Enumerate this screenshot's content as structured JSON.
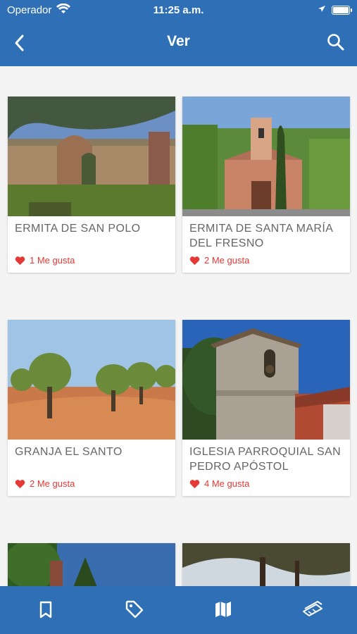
{
  "status": {
    "carrier": "Operador",
    "time": "11:25 a.m."
  },
  "nav": {
    "title": "Ver",
    "back_icon": "chevron-left-icon",
    "search_icon": "search-icon"
  },
  "places": [
    {
      "name": "ERMITA DE SAN POLO",
      "likes": "1 Me gusta"
    },
    {
      "name": "ERMITA DE SANTA MARÍA DEL FRESNO",
      "likes": "2 Me gusta"
    },
    {
      "name": "GRANJA EL SANTO",
      "likes": "2 Me gusta"
    },
    {
      "name": "IGLESIA PARROQUIAL SAN PEDRO APÓSTOL",
      "likes": "4 Me gusta"
    }
  ],
  "tabs": [
    "bookmark-icon",
    "tag-icon",
    "map-icon",
    "ticket-icon"
  ],
  "colors": {
    "brand": "#2f6fb6",
    "like": "#e53935",
    "text": "#666666"
  }
}
